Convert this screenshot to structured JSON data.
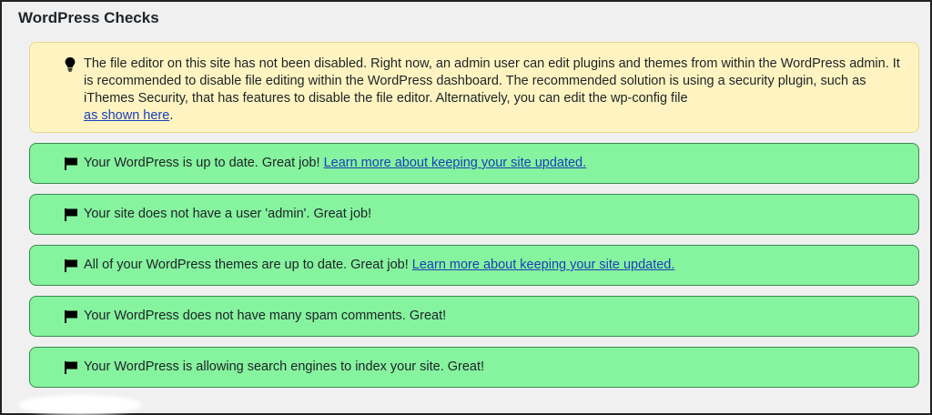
{
  "panel": {
    "title": "WordPress Checks"
  },
  "warning": {
    "icon": "lightbulb-icon",
    "text": "The file editor on this site has not been disabled. Right now, an admin user can edit plugins and themes from within the WordPress admin. It is recommended to disable file editing within the WordPress dashboard. The recommended solution is using a security plugin, such as iThemes Security, that has features to disable the file editor. Alternatively, you can edit the wp-config file",
    "link": "as shown here",
    "suffix": "."
  },
  "checks": [
    {
      "icon": "flag-icon",
      "text": "Your WordPress is up to date. Great job!",
      "link": "Learn more about keeping your site updated."
    },
    {
      "icon": "flag-icon",
      "text": "Your site does not have a user 'admin'. Great job!"
    },
    {
      "icon": "flag-icon",
      "text": "All of your WordPress themes are up to date. Great job!",
      "link": "Learn more about keeping your site updated."
    },
    {
      "icon": "flag-icon",
      "text": "Your WordPress does not have many spam comments. Great!"
    },
    {
      "icon": "flag-icon",
      "text": "Your WordPress is allowing search engines to index your site. Great!"
    }
  ],
  "colors": {
    "warning_bg": "#fff4c1",
    "success_bg": "#86f39f",
    "link": "#1a3fb8"
  }
}
